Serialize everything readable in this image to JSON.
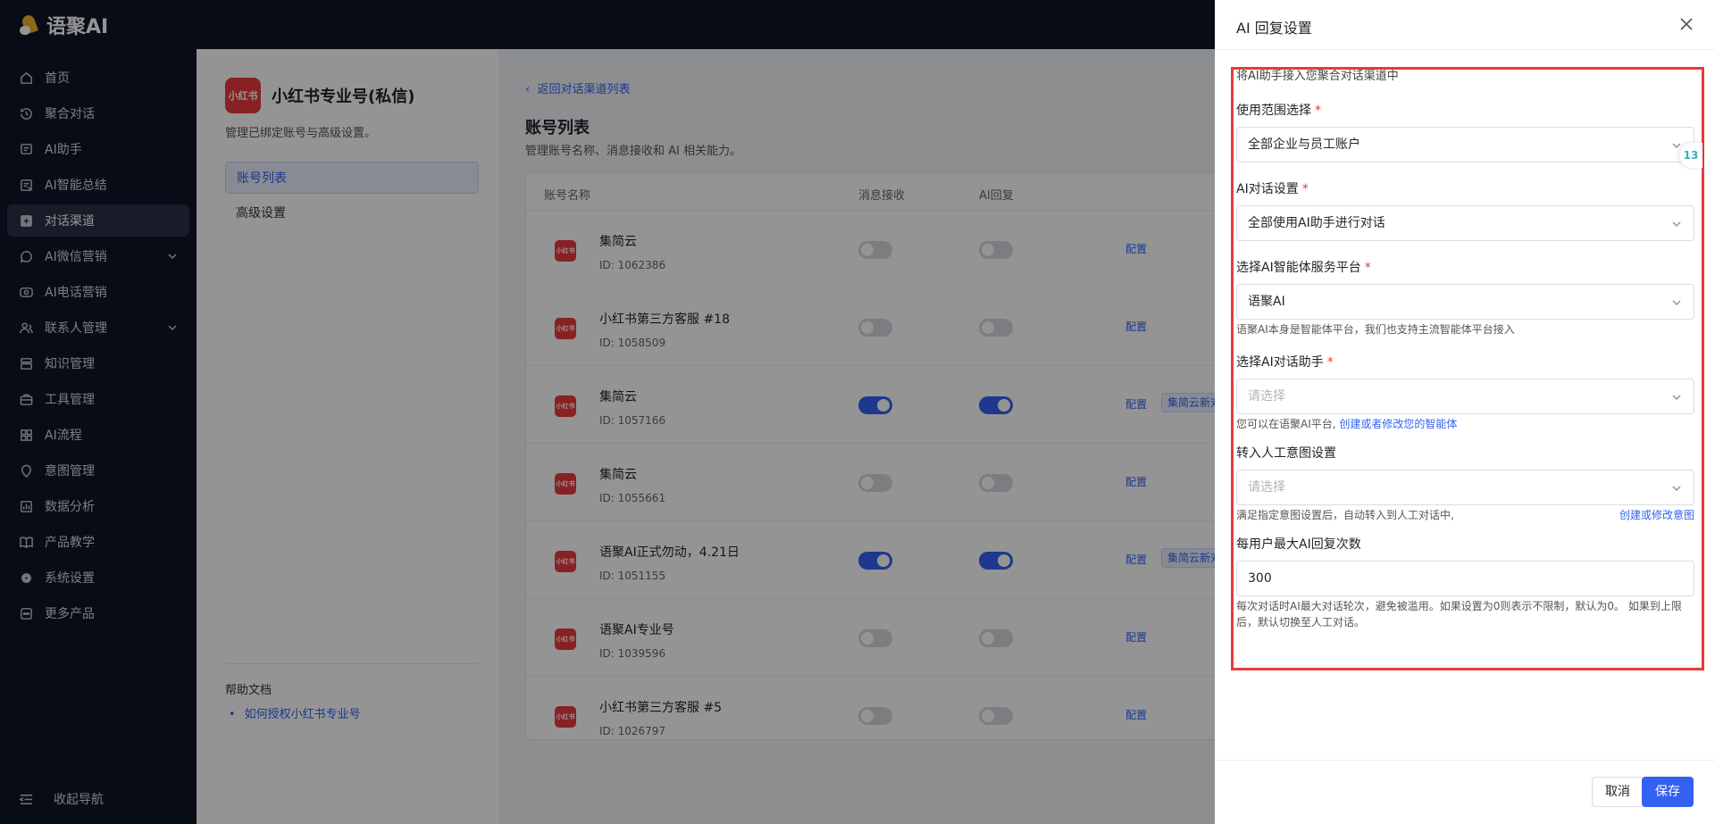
{
  "app": {
    "name": "语聚AI"
  },
  "sidebar": {
    "items": [
      {
        "label": "首页",
        "icon": "home-icon"
      },
      {
        "label": "聚合对话",
        "icon": "chat-history-icon"
      },
      {
        "label": "AI助手",
        "icon": "message-icon"
      },
      {
        "label": "AI智能总结",
        "icon": "summary-icon"
      },
      {
        "label": "对话渠道",
        "icon": "channel-icon",
        "active": true
      },
      {
        "label": "AI微信营销",
        "icon": "wechat-icon",
        "expandable": true
      },
      {
        "label": "AI电话营销",
        "icon": "phone-icon"
      },
      {
        "label": "联系人管理",
        "icon": "contacts-icon",
        "expandable": true
      },
      {
        "label": "知识管理",
        "icon": "knowledge-icon"
      },
      {
        "label": "工具管理",
        "icon": "toolbox-icon"
      },
      {
        "label": "AI流程",
        "icon": "grid-icon"
      },
      {
        "label": "意图管理",
        "icon": "bulb-icon"
      },
      {
        "label": "数据分析",
        "icon": "chart-icon"
      },
      {
        "label": "产品教学",
        "icon": "book-icon"
      },
      {
        "label": "系统设置",
        "icon": "gear-icon"
      },
      {
        "label": "更多产品",
        "icon": "more-icon"
      }
    ],
    "collapse_label": "收起导航"
  },
  "channel_panel": {
    "title": "小红书专业号(私信)",
    "logo_text": "小红书",
    "description": "管理已绑定账号与高级设置。",
    "menu": [
      "账号列表",
      "高级设置"
    ],
    "help_title": "帮助文档",
    "help_link": "如何授权小红书专业号"
  },
  "main": {
    "back_link": "返回对话渠道列表",
    "title": "账号列表",
    "description": "管理账号名称、消息接收和 AI 相关能力。",
    "columns": [
      "账号名称",
      "消息接收",
      "AI回复"
    ],
    "config_label": "配置",
    "rows": [
      {
        "name": "集简云",
        "id": "ID: 1062386",
        "receive": false,
        "ai_reply": false,
        "tag": ""
      },
      {
        "name": "小红书第三方客服 #18",
        "id": "ID: 1058509",
        "receive": false,
        "ai_reply": false,
        "tag": ""
      },
      {
        "name": "集简云",
        "id": "ID: 1057166",
        "receive": true,
        "ai_reply": true,
        "tag": "集简云新对"
      },
      {
        "name": "集简云",
        "id": "ID: 1055661",
        "receive": false,
        "ai_reply": false,
        "tag": ""
      },
      {
        "name": "语聚AI正式勿动，4.21日",
        "id": "ID: 1051155",
        "receive": true,
        "ai_reply": true,
        "tag": "集简云新对"
      },
      {
        "name": "语聚AI专业号",
        "id": "ID: 1039596",
        "receive": false,
        "ai_reply": false,
        "tag": ""
      },
      {
        "name": "小红书第三方客服 #5",
        "id": "ID: 1026797",
        "receive": false,
        "ai_reply": false,
        "tag": ""
      }
    ]
  },
  "drawer": {
    "title": "AI 回复设置",
    "intro": "将AI助手接入您聚合对话渠道中",
    "scope": {
      "label": "使用范围选择",
      "value": "全部企业与员工账户"
    },
    "dialog": {
      "label": "AI对话设置",
      "value": "全部使用AI助手进行对话"
    },
    "platform": {
      "label": "选择AI智能体服务平台",
      "value": "语聚AI",
      "help": "语聚AI本身是智能体平台，我们也支持主流智能体平台接入"
    },
    "assistant": {
      "label": "选择AI对话助手",
      "placeholder": "请选择",
      "help_prefix": "您可以在语聚AI平台,",
      "help_link": "创建或者修改您的智能体"
    },
    "handoff": {
      "label": "转入人工意图设置",
      "placeholder": "请选择",
      "help": "满足指定意图设置后，自动转入到人工对话中,",
      "help_link": "创建或修改意图"
    },
    "max_reply": {
      "label": "每用户最大AI回复次数",
      "value": "300",
      "help": "每次对话时AI最大对话轮次，避免被滥用。如果设置为0则表示不限制，默认为0。 如果到上限后，默认切换至人工对话。"
    },
    "cancel_label": "取消",
    "save_label": "保存",
    "side_widget_text": "13"
  },
  "colors": {
    "accent": "#3361f2",
    "danger": "#e83a3a",
    "sidebar_bg": "#0f1629",
    "xhs_red": "#ea3a3f"
  }
}
